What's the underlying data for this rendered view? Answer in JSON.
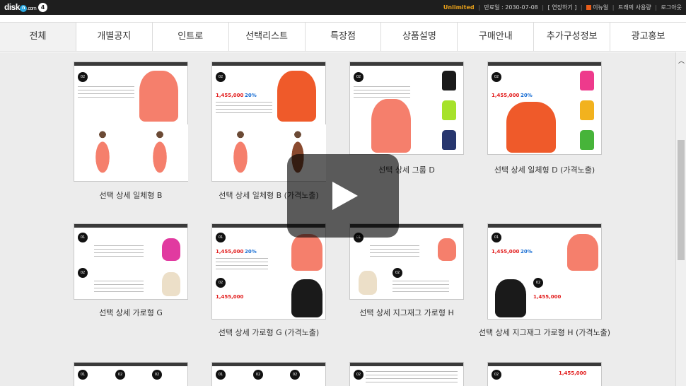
{
  "topbar": {
    "logo": "disk",
    "logo_ball": "n",
    "logo_domain": ".com",
    "logo_badge": "4",
    "brand": "Unlimited",
    "expiry": "만료일 : 2030-07-08",
    "extend": "[ 연장하기 ]",
    "news": "이뉴얼",
    "traffic": "트래픽 사용량",
    "logout": "로그아웃"
  },
  "nav": {
    "tabs": [
      {
        "label": "전체"
      },
      {
        "label": "개별공지"
      },
      {
        "label": "인트로"
      },
      {
        "label": "선택리스트"
      },
      {
        "label": "특장점"
      },
      {
        "label": "상품설명"
      },
      {
        "label": "구매안내"
      },
      {
        "label": "추가구성정보"
      },
      {
        "label": "광고홍보"
      }
    ]
  },
  "cards": {
    "r1": [
      {
        "caption": "선택 상세 일체형 B"
      },
      {
        "caption": "선택 상세 일체형 B (가격노출)",
        "price": "1,455,000",
        "pct": "20%"
      },
      {
        "caption": "선택 상세 그룹 D"
      },
      {
        "caption": "선택 상세 일체형 D (가격노출)",
        "price": "1,455,000",
        "pct": "20%"
      }
    ],
    "r2": [
      {
        "caption": "선택 상세 가로형 G"
      },
      {
        "caption": "선택 상세 가로형 G (가격노출)",
        "price1": "1,455,000",
        "pct1": "20%",
        "price2": "1,455,000"
      },
      {
        "caption": "선택 상세 지그재그 가로형 H"
      },
      {
        "caption": "선택 상세 지그재그 가로형 H (가격노출)",
        "price1": "1,455,000",
        "pct1": "20%",
        "price2": "1,455,000"
      }
    ],
    "num_01": "01",
    "num_02": "02",
    "r3_price": "1,455,000"
  },
  "colors": {
    "salmon": "#f57f6c",
    "orange_red": "#ef5a2a",
    "black": "#1a1a1a",
    "lime": "#a6e22a",
    "navy": "#27366e",
    "pink": "#ee3a8c",
    "yellow": "#f2b21e",
    "green": "#47b43a",
    "cream": "#ecdfc8",
    "magenta": "#e13aa0"
  },
  "icons": {
    "play": "play-icon",
    "scroll_up": "chevron-up-icon",
    "news": "news-icon"
  }
}
